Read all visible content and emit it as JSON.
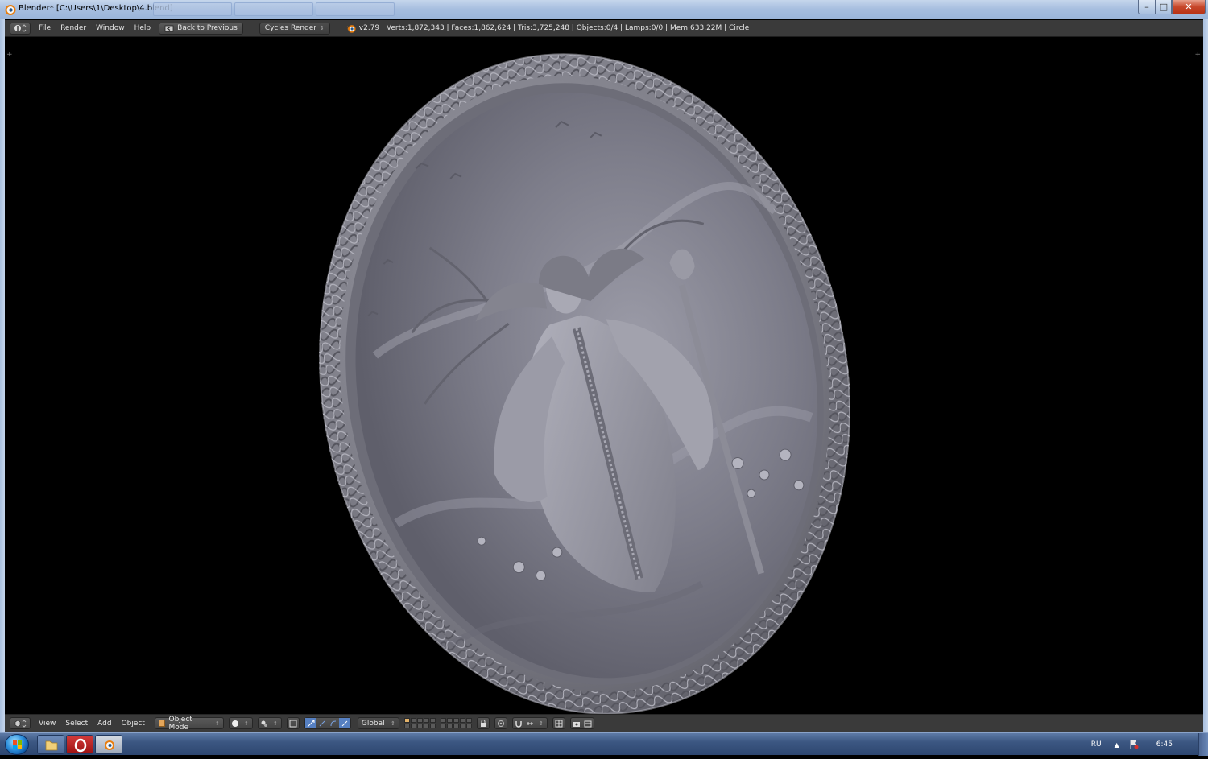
{
  "window": {
    "title": "Blender* [C:\\Users\\1\\Desktop\\4.blend]",
    "minimize_glyph": "–",
    "maximize_glyph": "□",
    "close_glyph": "✕"
  },
  "info_header": {
    "menus": [
      "File",
      "Render",
      "Window",
      "Help"
    ],
    "back_button": "Back to Previous",
    "render_engine": "Cycles Render",
    "stats": "v2.79 | Verts:1,872,343 | Faces:1,862,624 | Tris:3,725,248 | Objects:0/4 | Lamps:0/0 | Mem:633.22M | Circle"
  },
  "view3d_header": {
    "menus": [
      "View",
      "Select",
      "Add",
      "Object"
    ],
    "mode": "Object Mode",
    "orientation": "Global"
  },
  "taskbar": {
    "language": "RU",
    "clock": "6:45"
  },
  "colors": {
    "viewport_bg": "#000000",
    "plate": "#8a8a94",
    "header_bg": "#3a3a3a",
    "accent_orange": "#e3a55a"
  }
}
